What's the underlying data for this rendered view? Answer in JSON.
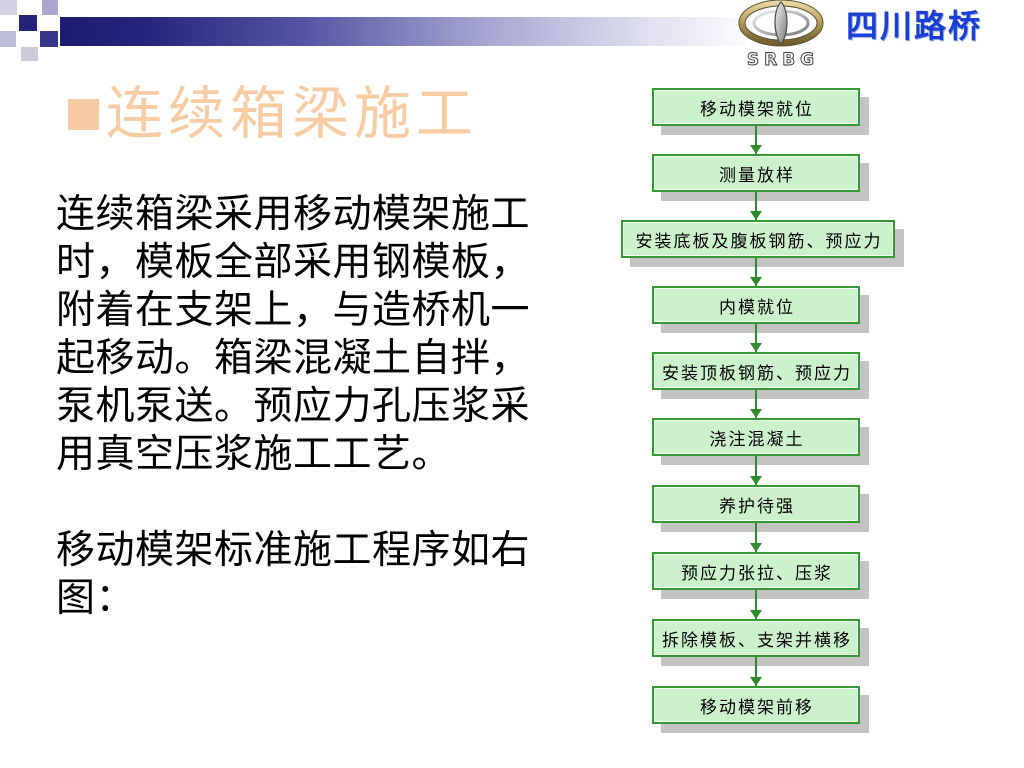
{
  "header": {
    "brand_name": "四川路桥",
    "logo_text": "SRBG"
  },
  "title": {
    "text": "连续箱梁施工"
  },
  "body": {
    "paragraphs": [
      {
        "lines": [
          "连续箱梁采用移动模架施工",
          "时，模板全部采用钢模板，",
          "附着在支架上，与造桥机一",
          "起移动。箱梁混凝土自拌，",
          "泵机泵送。预应力孔压浆采",
          "用真空压浆施工工艺。"
        ]
      },
      {
        "lines": [
          "移动模架标准施工程序如右",
          "图："
        ]
      }
    ]
  },
  "flowchart": {
    "steps": [
      "移动模架就位",
      "测量放样",
      "安装底板及腹板钢筋、预应力",
      "内模就位",
      "安装顶板钢筋、预应力",
      "浇注混凝土",
      "养护待强",
      "预应力张拉、压浆",
      "拆除模板、支架并横移",
      "移动模架前移"
    ]
  },
  "theme": {
    "brand_blue": "#1a3fd6",
    "title_color": "#f8cba2",
    "header_bar_dark": "#1c1c72",
    "box_fill": "#ccf2cc",
    "box_border": "#349a34",
    "arrow_color": "#2e8b2e"
  }
}
